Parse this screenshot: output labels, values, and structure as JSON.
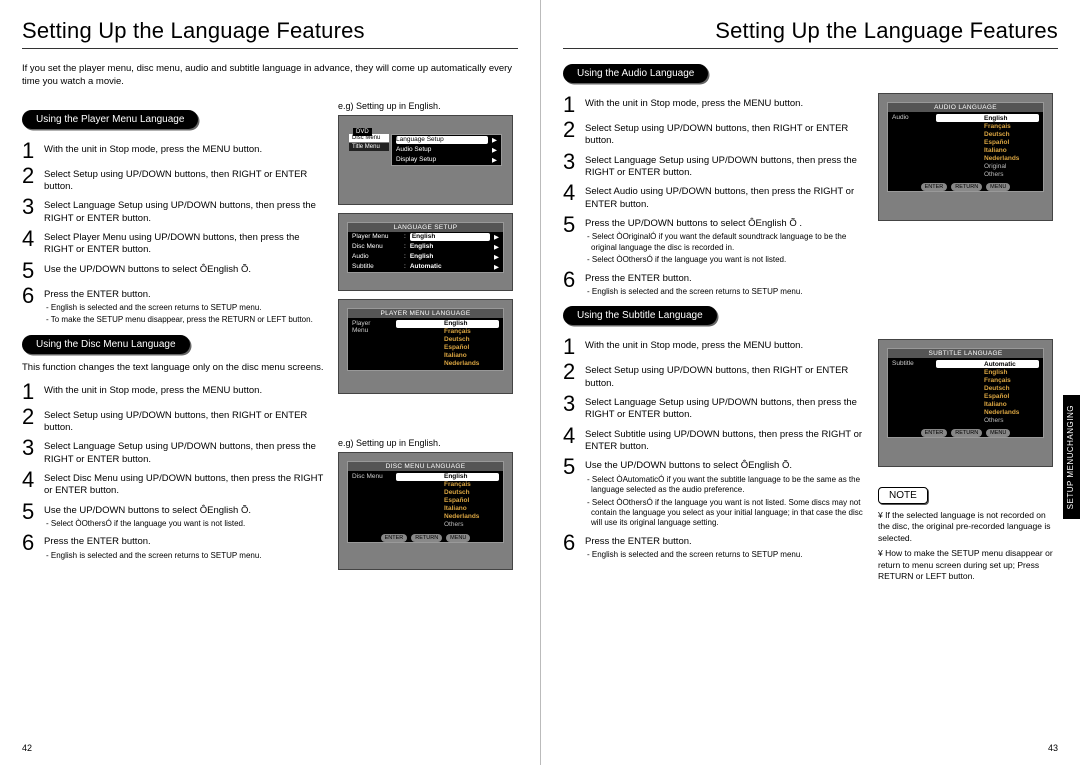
{
  "title": "Setting Up the Language Features",
  "intro": "If you set the player menu, disc menu, audio and subtitle language in advance, they will come up automatically every time you watch a movie.",
  "eg": "e.g) Setting up in English.",
  "page_left": "42",
  "page_right": "43",
  "side_tab": {
    "l1": "CHANGING",
    "l2": "SETUP MENU"
  },
  "sections": {
    "player": {
      "pill": "Using the Player Menu Language",
      "steps": [
        "With the unit in Stop mode, press the MENU button.",
        "Select Setup  using UP/DOWN buttons, then RIGHT or ENTER button.",
        "Select Language Setup  using UP/DOWN buttons, then press the RIGHT or ENTER button.",
        "Select Player Menu  using UP/DOWN buttons, then press the RIGHT or ENTER button.",
        "Use the UP/DOWN buttons to select ÔEnglish Õ.",
        "Press the ENTER button."
      ],
      "subnotes": [
        "- English is selected and the screen returns to SETUP menu.",
        "- To make the SETUP menu disappear, press the RETURN or LEFT button."
      ]
    },
    "disc": {
      "pill": "Using the Disc Menu Language",
      "lead": "This function changes the text language only on the disc menu screens.",
      "steps": [
        "With the unit in Stop mode, press the MENU button.",
        "Select Setup  using UP/DOWN buttons, then RIGHT or ENTER button.",
        "Select Language Setup  using UP/DOWN buttons, then press the RIGHT or ENTER button.",
        "Select Disc Menu  using UP/DOWN buttons, then press the RIGHT or ENTER button.",
        "Use the UP/DOWN buttons to select ÔEnglish Õ."
      ],
      "sub5": "- Select ÒOthersÓ if the language you want is not listed.",
      "step6": "Press the ENTER button.",
      "sub6": "- English is selected and the screen returns to SETUP menu."
    },
    "audio": {
      "pill": "Using the Audio Language",
      "steps": [
        "With the unit in Stop mode, press the MENU button.",
        "Select Setup  using UP/DOWN buttons, then RIGHT or ENTER button.",
        "Select Language Setup  using UP/DOWN buttons, then press the RIGHT or ENTER button.",
        "Select Audio  using UP/DOWN buttons, then press the RIGHT or ENTER button.",
        "Press the UP/DOWN buttons to select ÔEnglish Õ ."
      ],
      "sub5": [
        "- Select ÒOriginalÓ if you want the default soundtrack language to be the original language the disc is recorded in.",
        "- Select ÒOthersÓ if the language you want is not listed."
      ],
      "step6": "Press the ENTER button.",
      "sub6": "- English is selected and the screen returns to SETUP menu."
    },
    "subtitle": {
      "pill": "Using the Subtitle Language",
      "steps": [
        "With the unit in Stop mode, press the MENU button.",
        "Select Setup  using UP/DOWN buttons, then RIGHT or ENTER button.",
        "Select Language Setup  using UP/DOWN buttons, then press the RIGHT or ENTER button.",
        "Select Subtitle  using UP/DOWN buttons, then press the RIGHT or ENTER button.",
        "Use the UP/DOWN buttons to select ÔEnglish Õ."
      ],
      "sub5": [
        "- Select ÒAutomaticÓ if you want the subtitle language to be the same as the language selected as the audio preference.",
        "- Select ÒOthersÓ if the language you want is not listed. Some discs may not contain the language you  select as your initial language; in that case the disc will use its original language setting."
      ],
      "step6": "Press the ENTER button.",
      "sub6": "- English is selected and the screen returns to SETUP menu."
    }
  },
  "note": {
    "label": "NOTE",
    "items": [
      "¥ If the selected language is not recorded on the disc, the original pre-recorded language is selected.",
      "¥ How to make the SETUP menu disappear or  return to menu screen during set up;   Press RETURN or LEFT button."
    ]
  },
  "osd": {
    "dvd": "DVD",
    "setup_side": [
      "Disc Menu",
      "Title Menu"
    ],
    "lang_setup_title": "LANGUAGE SETUP",
    "lang_setup_rows": [
      {
        "k": "Player Menu",
        "v": "English",
        "hi": true
      },
      {
        "k": "Disc Menu",
        "v": "English"
      },
      {
        "k": "Audio",
        "v": "English"
      },
      {
        "k": "Subtitle",
        "v": "Automatic"
      }
    ],
    "setup_rows": [
      {
        "k": "Language Setup",
        "hi": true
      },
      {
        "k": "Audio Setup"
      },
      {
        "k": "Display Setup"
      }
    ],
    "player_menu_title": "PLAYER MENU LANGUAGE",
    "player_menu_lab": "Player Menu",
    "langs_player": [
      "English",
      "Français",
      "Deutsch",
      "Español",
      "Italiano",
      "Nederlands"
    ],
    "disc_menu_title": "DISC MENU LANGUAGE",
    "disc_menu_lab": "Disc Menu",
    "langs_disc": [
      "English",
      "Français",
      "Deutsch",
      "Español",
      "Italiano",
      "Nederlands",
      "Others"
    ],
    "audio_title": "AUDIO LANGUAGE",
    "audio_lab": "Audio",
    "langs_audio": [
      "English",
      "Français",
      "Deutsch",
      "Español",
      "Italiano",
      "Nederlands",
      "Original",
      "Others"
    ],
    "sub_title": "SUBTITLE LANGUAGE",
    "sub_lab": "Subtitle",
    "langs_sub": [
      "Automatic",
      "English",
      "Français",
      "Deutsch",
      "Español",
      "Italiano",
      "Nederlands",
      "Others"
    ],
    "btns": [
      "ENTER",
      "RETURN",
      "MENU"
    ]
  }
}
